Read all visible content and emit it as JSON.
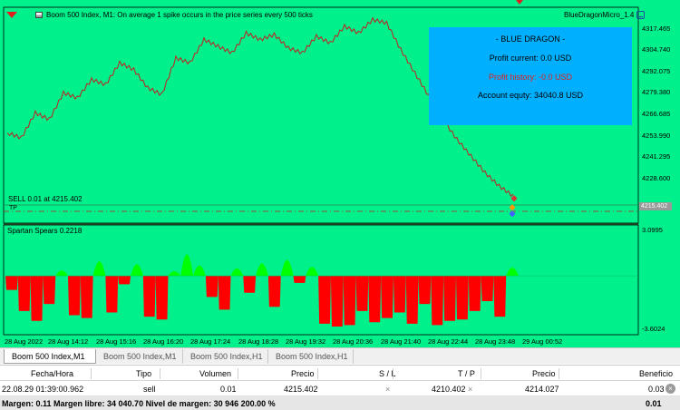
{
  "chart": {
    "title": "Boom 500 Index, M1:  On average 1 spike occurs in the price series every 500 ticks",
    "ea_name": "BlueDragonMicro_1.4",
    "info_box": {
      "title": "- BLUE DRAGON -",
      "profit_current": "Profit current: 0.0 USD",
      "profit_history": "Profit history: -0.0 USD",
      "account_equity": "Account equty: 34040.8 USD",
      "history_color": "#e02020"
    },
    "sell_label": "SELL 0.01 at 4215.402",
    "tp_label": "TP",
    "current_price": "4215.402",
    "indicator_name": "Spartan Spears 0.2218",
    "price_ticks": [
      "4317.465",
      "4304.740",
      "4292.075",
      "4279.380",
      "4266.685",
      "4253.990",
      "4241.295",
      "4228.600"
    ],
    "indicator_ticks": [
      "3.0995",
      "-3.6024"
    ],
    "time_ticks": [
      "28 Aug 2022",
      "28 Aug 14:12",
      "28 Aug 15:16",
      "28 Aug 16:20",
      "28 Aug 17:24",
      "28 Aug 18:28",
      "28 Aug 19:32",
      "28 Aug 20:36",
      "28 Aug 21:40",
      "28 Aug 22:44",
      "28 Aug 23:48",
      "29 Aug 00:52"
    ],
    "colors": {
      "background": "#00f08c",
      "price_line": "#c02020",
      "ind_pos": "#00ff00",
      "ind_neg": "#ff0000",
      "info_box": "#00b0ff"
    }
  },
  "chart_data": {
    "type": "line",
    "title": "Boom 500 Index, M1",
    "price_series": [
      4254,
      4251,
      4266,
      4262,
      4278,
      4275,
      4286,
      4283,
      4296,
      4292,
      4281,
      4277,
      4299,
      4296,
      4310,
      4306,
      4302,
      4314,
      4310,
      4313,
      4305,
      4302,
      4312,
      4308,
      4318,
      4314,
      4322,
      4320,
      4304,
      4290,
      4276,
      4262,
      4250,
      4240,
      4230,
      4222,
      4216
    ],
    "indicator_series": [
      -1.0,
      -2.5,
      -3.2,
      -2.0,
      0.5,
      -2.8,
      -3.0,
      1.8,
      -2.6,
      -0.6,
      1.4,
      -2.9,
      -3.1,
      0.4,
      2.8,
      1.2,
      -1.5,
      -2.4,
      0.8,
      -1.2,
      1.5,
      -2.2,
      2.0,
      -0.5,
      1.0,
      -3.4,
      -3.6,
      -3.5,
      -2.5,
      -3.3,
      -3.0,
      -2.6,
      -3.4,
      -2.0,
      -3.5,
      -3.2,
      -3.1,
      -2.5,
      -1.8,
      -2.9,
      0.9
    ],
    "indicator_range": [
      -3.6024,
      3.0995
    ]
  },
  "tabs": [
    {
      "label": "Boom 500 Index,M1"
    },
    {
      "label": "Boom 500 Index,M1"
    },
    {
      "label": "Boom 500 Index,H1"
    },
    {
      "label": "Boom 500 Index,H1"
    }
  ],
  "trade": {
    "headers": [
      "Fecha/Hora",
      "Tipo",
      "Volumen",
      "Precio",
      "S / L",
      "T / P",
      "Precio",
      "Beneficio"
    ],
    "row": {
      "time": "22.08.29 01:39:00.962",
      "type": "sell",
      "volume": "0.01",
      "price": "4215.402",
      "sl": "",
      "tp": "4210.402",
      "cur_price": "4214.027",
      "profit": "0.03"
    },
    "summary": "Margen: 0.11  Margen libre: 34 040.70  Nivel de margen: 30 946 200.00 %",
    "summary_total": "0.01"
  }
}
